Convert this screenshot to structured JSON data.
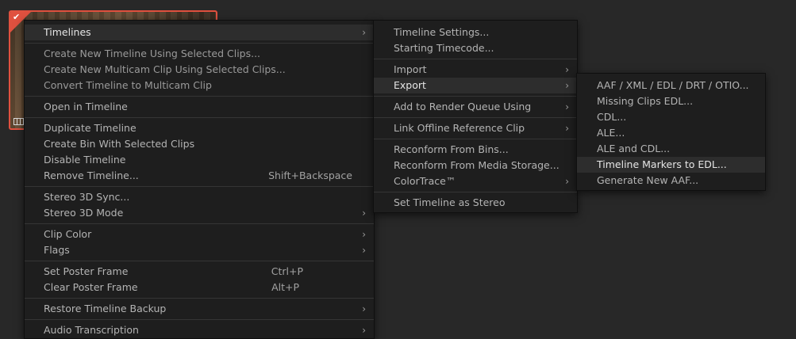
{
  "menu_main": {
    "timelines": "Timelines",
    "create_new_timeline": "Create New Timeline Using Selected Clips...",
    "create_multicam": "Create New Multicam Clip Using Selected Clips...",
    "convert_multicam": "Convert Timeline to Multicam Clip",
    "open_in_timeline": "Open in Timeline",
    "duplicate_timeline": "Duplicate Timeline",
    "create_bin": "Create Bin With Selected Clips",
    "disable_timeline": "Disable Timeline",
    "remove_timeline": "Remove Timeline...",
    "remove_shortcut": "Shift+Backspace",
    "stereo_sync": "Stereo 3D Sync...",
    "stereo_mode": "Stereo 3D Mode",
    "clip_color": "Clip Color",
    "flags": "Flags",
    "set_poster": "Set Poster Frame",
    "set_poster_shortcut": "Ctrl+P",
    "clear_poster": "Clear Poster Frame",
    "clear_poster_shortcut": "Alt+P",
    "restore_backup": "Restore Timeline Backup",
    "audio_transcription": "Audio Transcription"
  },
  "menu_timelines": {
    "timeline_settings": "Timeline Settings...",
    "starting_timecode": "Starting Timecode...",
    "import": "Import",
    "export": "Export",
    "add_render_queue": "Add to Render Queue Using",
    "link_offline": "Link Offline Reference Clip",
    "reconform_bins": "Reconform From Bins...",
    "reconform_media": "Reconform From Media Storage...",
    "colortrace": "ColorTrace™",
    "set_stereo": "Set Timeline as Stereo"
  },
  "menu_export": {
    "aaf_xml": "AAF / XML / EDL / DRT / OTIO...",
    "missing_clips": "Missing Clips EDL...",
    "cdl": "CDL...",
    "ale": "ALE...",
    "ale_cdl": "ALE and CDL...",
    "markers_edl": "Timeline Markers to EDL...",
    "generate_aaf": "Generate New AAF..."
  },
  "icons": {
    "submenu_arrow": "chevron-right-icon",
    "selected_check": "checkmark-icon",
    "timeline_icon": "timeline-icon"
  },
  "colors": {
    "selection_border": "#e0513f",
    "menu_bg": "#1e1e1e",
    "highlight_bg": "#2d2d2d"
  }
}
